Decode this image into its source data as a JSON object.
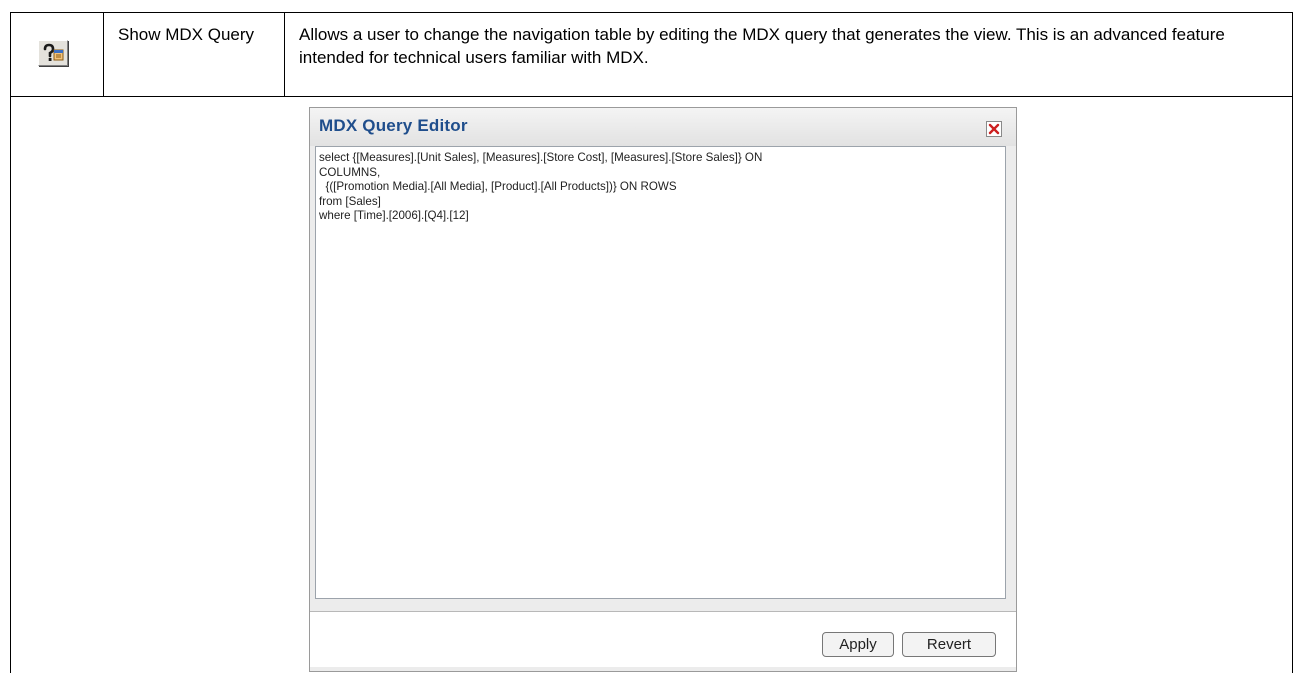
{
  "feature_row": {
    "icon": "mdx-query-icon",
    "name": "Show MDX Query",
    "description": "Allows a user to change the navigation table by editing the MDX query that generates the view. This is an advanced feature intended for technical users familiar with MDX."
  },
  "dialog": {
    "title": "MDX Query Editor",
    "close_icon": "close-icon",
    "query": "select {[Measures].[Unit Sales], [Measures].[Store Cost], [Measures].[Store Sales]} ON\nCOLUMNS,\n  {([Promotion Media].[All Media], [Product].[All Products])} ON ROWS\nfrom [Sales]\nwhere [Time].[2006].[Q4].[12]",
    "apply_label": "Apply",
    "revert_label": "Revert"
  },
  "colors": {
    "title_text": "#1f4e8c",
    "close_x": "#cc1f1f"
  }
}
